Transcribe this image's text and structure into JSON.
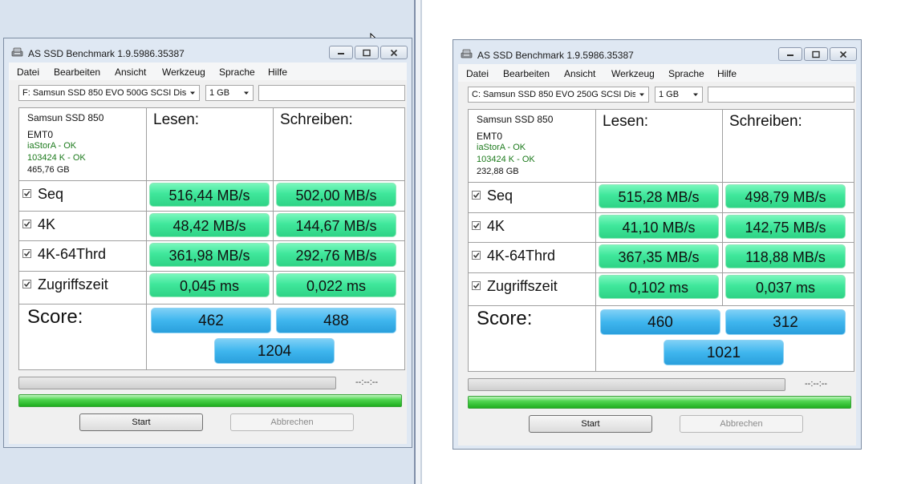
{
  "windows": [
    {
      "title": "AS SSD Benchmark 1.9.5986.35387",
      "menu": [
        "Datei",
        "Bearbeiten",
        "Ansicht",
        "Werkzeug",
        "Sprache",
        "Hilfe"
      ],
      "drive": "F: Samsun  SSD 850 EVO 500G SCSI Dis",
      "size": "1 GB",
      "device": {
        "name": "Samsun  SSD 850",
        "firmware": "EMT0",
        "driver_status": "iaStorA - OK",
        "align_status": "103424 K - OK",
        "capacity": "465,76 GB"
      },
      "headers": {
        "read": "Lesen:",
        "write": "Schreiben:"
      },
      "rows": [
        {
          "label": "Seq",
          "read": "516,44 MB/s",
          "write": "502,00 MB/s"
        },
        {
          "label": "4K",
          "read": "48,42 MB/s",
          "write": "144,67 MB/s"
        },
        {
          "label": "4K-64Thrd",
          "read": "361,98 MB/s",
          "write": "292,76 MB/s"
        },
        {
          "label": "Zugriffszeit",
          "read": "0,045 ms",
          "write": "0,022 ms"
        }
      ],
      "score": {
        "label": "Score:",
        "read": "462",
        "write": "488",
        "total": "1204"
      },
      "time": "--:--:--",
      "progress_bar": 0,
      "overall_progress": 1,
      "buttons": {
        "start": "Start",
        "cancel": "Abbrechen"
      }
    },
    {
      "title": "AS SSD Benchmark 1.9.5986.35387",
      "menu": [
        "Datei",
        "Bearbeiten",
        "Ansicht",
        "Werkzeug",
        "Sprache",
        "Hilfe"
      ],
      "drive": "C: Samsun  SSD 850 EVO 250G SCSI Dis",
      "size": "1 GB",
      "device": {
        "name": "Samsun  SSD 850",
        "firmware": "EMT0",
        "driver_status": "iaStorA - OK",
        "align_status": "103424 K - OK",
        "capacity": "232,88 GB"
      },
      "headers": {
        "read": "Lesen:",
        "write": "Schreiben:"
      },
      "rows": [
        {
          "label": "Seq",
          "read": "515,28 MB/s",
          "write": "498,79 MB/s"
        },
        {
          "label": "4K",
          "read": "41,10 MB/s",
          "write": "142,75 MB/s"
        },
        {
          "label": "4K-64Thrd",
          "read": "367,35 MB/s",
          "write": "118,88 MB/s"
        },
        {
          "label": "Zugriffszeit",
          "read": "0,102 ms",
          "write": "0,037 ms"
        }
      ],
      "score": {
        "label": "Score:",
        "read": "460",
        "write": "312",
        "total": "1021"
      },
      "time": "--:--:--",
      "progress_bar": 0,
      "overall_progress": 1,
      "buttons": {
        "start": "Start",
        "cancel": "Abbrechen"
      }
    }
  ],
  "colors": {
    "result_green": "#3fe79b",
    "score_blue": "#3fb6ee",
    "ok_text": "#1c7a1c",
    "progress_green": "#1fae1f"
  }
}
